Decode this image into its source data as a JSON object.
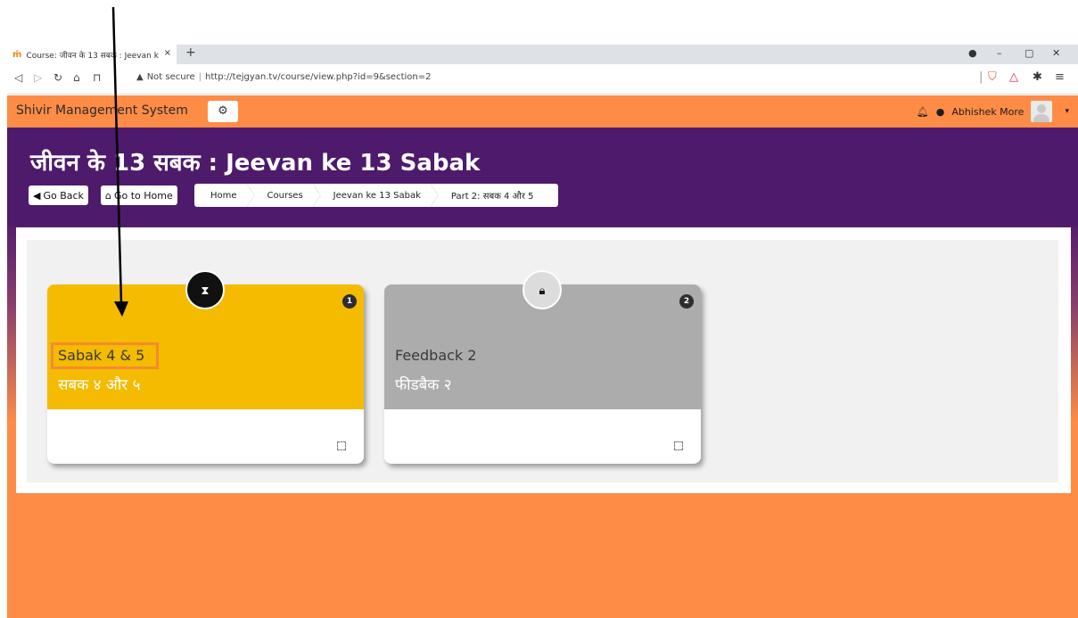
{
  "browser": {
    "tab_title": "Course: जीवन के 13 सबक : Jeevan k",
    "tab_close": "×",
    "new_tab": "+",
    "address_warning": "Not secure",
    "url": "http://tejgyan.tv/course/view.php?id=9&section=2"
  },
  "topnav": {
    "brand": "Shivir Management System",
    "user_name": "Abhishek More"
  },
  "header": {
    "title": "जीवन के 13 सबक : Jeevan ke 13 Sabak",
    "go_back": "Go Back",
    "go_home": "Go to Home",
    "breadcrumbs": [
      "Home",
      "Courses",
      "Jeevan ke 13 Sabak",
      "Part 2: सबक 4 और 5"
    ]
  },
  "cards": [
    {
      "number": "1",
      "title_en": "Sabak 4 & 5",
      "title_hi": "सबक ४ और ५",
      "status_icon": "hourglass-icon",
      "color": "#f4bb00"
    },
    {
      "number": "2",
      "title_en": "Feedback 2",
      "title_hi": "फीडबैक २",
      "status_icon": "lock-icon",
      "color": "#acacac"
    }
  ],
  "colors": {
    "orange": "#fe8c46",
    "purple": "#4e1a6c",
    "highlight": "#f58a2e"
  }
}
